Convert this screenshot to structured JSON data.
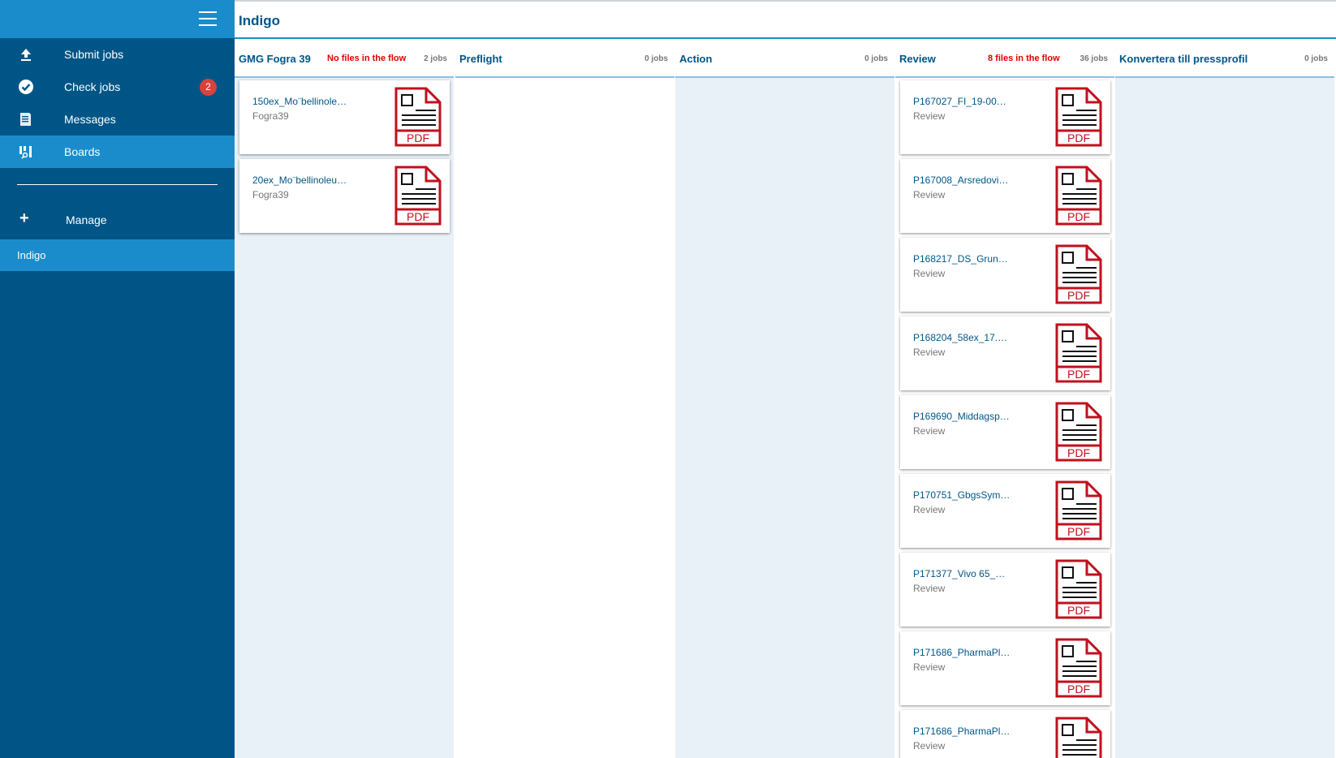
{
  "sidebar": {
    "items": [
      {
        "label": "Submit jobs",
        "icon": "upload-icon"
      },
      {
        "label": "Check jobs",
        "icon": "check-circle-icon",
        "badge": "2"
      },
      {
        "label": "Messages",
        "icon": "messages-icon"
      },
      {
        "label": "Boards",
        "icon": "boards-icon",
        "active": true
      }
    ],
    "manage_label": "Manage",
    "board_label": "Indigo"
  },
  "header": {
    "title": "Indigo"
  },
  "columns": [
    {
      "name": "GMG Fogra 39",
      "flow": "No files in the flow",
      "count": "2 jobs",
      "cards": [
        {
          "file": "150ex_Mo¨bellinole…",
          "sub": "Fogra39"
        },
        {
          "file": "20ex_Mo¨bellinoleu…",
          "sub": "Fogra39"
        }
      ]
    },
    {
      "name": "Preflight",
      "flow": "",
      "count": "0 jobs",
      "cards": []
    },
    {
      "name": "Action",
      "flow": "",
      "count": "0 jobs",
      "cards": []
    },
    {
      "name": "Review",
      "flow": "8 files in the flow",
      "count": "36 jobs",
      "cards": [
        {
          "file": "P167027_FI_19-00…",
          "sub": "Review"
        },
        {
          "file": "P167008_Arsredovi…",
          "sub": "Review"
        },
        {
          "file": "P168217_DS_Grun…",
          "sub": "Review"
        },
        {
          "file": "P168204_58ex_17.…",
          "sub": "Review"
        },
        {
          "file": "P169690_Middagsp…",
          "sub": "Review"
        },
        {
          "file": "P170751_GbgsSym…",
          "sub": "Review"
        },
        {
          "file": "P171377_Vivo 65_…",
          "sub": "Review"
        },
        {
          "file": "P171686_PharmaPl…",
          "sub": "Review"
        },
        {
          "file": "P171686_PharmaPl…",
          "sub": "Review"
        }
      ]
    },
    {
      "name": "Konvertera till pressprofil",
      "flow": "",
      "count": "0 jobs",
      "cards": []
    }
  ],
  "pdf_label": "PDF",
  "colors": {
    "sidebar": "#005587",
    "sidebar_active": "#1a8ccb",
    "badge": "#d9423a",
    "pdf_red": "#c0101e",
    "alert_red": "#e00000"
  }
}
